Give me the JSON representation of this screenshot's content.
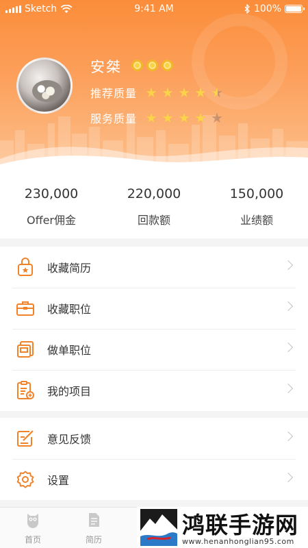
{
  "status_bar": {
    "carrier": "Sketch",
    "time": "9:41 AM",
    "battery": "100%"
  },
  "profile": {
    "name": "安桀",
    "medal_count": 3,
    "ratings": [
      {
        "label": "推荐质量",
        "value": 4.5,
        "max": 5
      },
      {
        "label": "服务质量",
        "value": 4,
        "max": 5
      }
    ]
  },
  "stats": [
    {
      "value": "230,000",
      "label": "Offer佣金"
    },
    {
      "value": "220,000",
      "label": "回款额"
    },
    {
      "value": "150,000",
      "label": "业绩额"
    }
  ],
  "menu_group_1": [
    {
      "label": "收藏简历",
      "icon": "bag-icon"
    },
    {
      "label": "收藏职位",
      "icon": "briefcase-icon"
    },
    {
      "label": "做单职位",
      "icon": "document-stack-icon"
    },
    {
      "label": "我的项目",
      "icon": "clipboard-add-icon"
    }
  ],
  "menu_group_2": [
    {
      "label": "意见反馈",
      "icon": "edit-note-icon"
    },
    {
      "label": "设置",
      "icon": "gear-icon"
    }
  ],
  "tabbar": [
    {
      "label": "首页",
      "icon": "owl-home-icon"
    },
    {
      "label": "简历",
      "icon": "resume-icon"
    }
  ],
  "watermark": {
    "title": "鸿联手游网",
    "url": "www.henanhonglian95.com"
  },
  "colors": {
    "accent": "#f98a3c",
    "star": "#fbd24a",
    "icon": "#f0822a"
  }
}
